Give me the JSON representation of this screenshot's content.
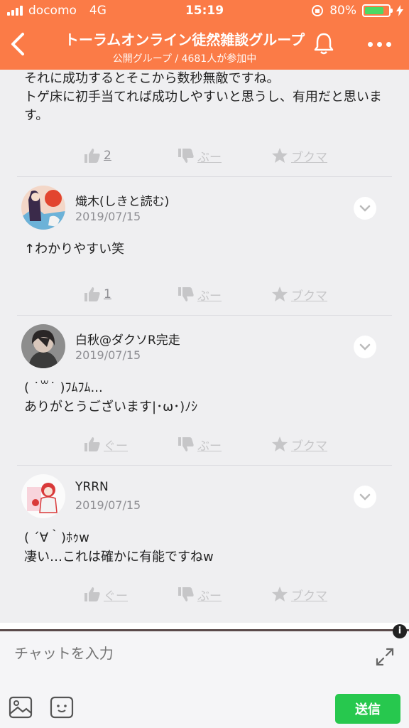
{
  "status_bar": {
    "carrier": "docomo",
    "network": "4G",
    "time": "15:19",
    "battery": "80%",
    "battery_level": 0.8
  },
  "header": {
    "title": "トーラムオンライン徒然雑談グループ",
    "subtitle": "公開グループ / 4681人が参加中"
  },
  "first_post": {
    "text": "それに成功するとそこから数秒無敵ですね。\nトゲ床に初手当てれば成功しやすいと思うし、有用だと思います。",
    "good_label": "2",
    "bad_label": "ぶー",
    "bookmark_label": "ブクマ"
  },
  "comments": [
    {
      "name": "熾木(しきと読む)",
      "date": "2019/07/15",
      "text": "↑わかりやすい笑",
      "good_label": "1",
      "bad_label": "ぶー",
      "bookmark_label": "ブクマ"
    },
    {
      "name": "白秋@ダクソR完走",
      "date": "2019/07/15",
      "text": "( ˙꒳˙ )ﾌﾑﾌﾑ...\nありがとうございます|･ω･)ﾉｼ",
      "good_label": "ぐー",
      "bad_label": "ぶー",
      "bookmark_label": "ブクマ"
    },
    {
      "name": "YRRN",
      "date": "2019/07/15",
      "text": "( ´∀｀)ﾎｩw\n凄い…これは確かに有能ですねw",
      "good_label": "ぐー",
      "bad_label": "ぶー",
      "bookmark_label": "ブクマ"
    }
  ],
  "composer": {
    "placeholder": "チャットを入力",
    "send_label": "送信",
    "info_label": "i"
  },
  "colors": {
    "accent": "#fb7b47",
    "send": "#27c84e",
    "icon_gray": "#c6c6c8"
  }
}
